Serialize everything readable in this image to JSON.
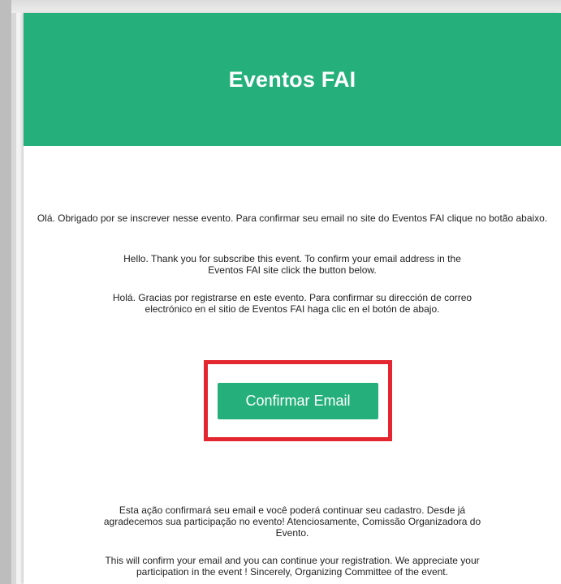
{
  "header": {
    "title": "Eventos FAI"
  },
  "messages": {
    "pt": "Olá. Obrigado por se inscrever nesse evento. Para confirmar seu email no site do Eventos FAI clique no botão abaixo.",
    "en": "Hello. Thank you for subscribe this event. To confirm your email address in the Eventos FAI site click the button below.",
    "es": "Holá. Gracias por registrarse en este evento. Para confirmar su dirección de correo electrónico en el sitio de Eventos FAI haga clic en el botón de abajo."
  },
  "cta": {
    "label": "Confirmar Email"
  },
  "footer": {
    "pt": "Esta ação confirmará seu email e você poderá continuar seu cadastro. Desde já agradecemos sua participação no evento! Atenciosamente, Comissão Organizadora do Evento.",
    "en": "This will confirm your email and you can continue your registration. We appreciate your participation in the event ! Sincerely, Organizing Committee of the event."
  },
  "colors": {
    "brand_green": "#25b07b",
    "highlight_red": "#e32630"
  }
}
